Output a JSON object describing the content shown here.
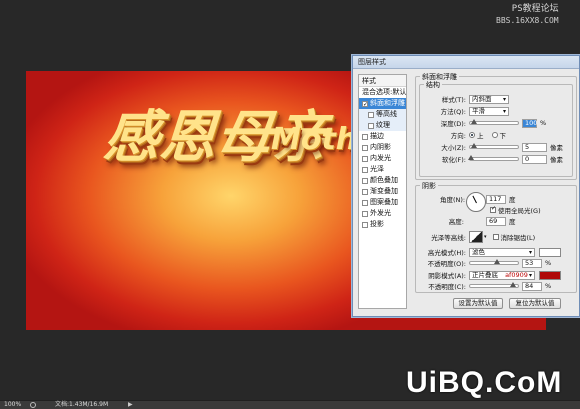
{
  "watermark": {
    "line1": "PS教程论坛",
    "line2": "BBS.16XX8.COM"
  },
  "logo": "UiBQ.CoM",
  "artwork": {
    "main_text": "感恩母亲",
    "sub_text": "Mothe"
  },
  "status": {
    "zoom": "100%",
    "doc_info": "文档:1.43M/16.9M"
  },
  "dialog": {
    "title": "图层样式",
    "left_panel": {
      "header": "样式",
      "items": [
        {
          "label": "混合选项:默认",
          "checkbox": false,
          "checked": false
        },
        {
          "label": "斜面和浮雕",
          "checkbox": true,
          "checked": true,
          "selected": true
        },
        {
          "label": "等高线",
          "checkbox": true,
          "checked": false,
          "sub": true
        },
        {
          "label": "纹理",
          "checkbox": true,
          "checked": false,
          "sub": true
        },
        {
          "label": "描边",
          "checkbox": true,
          "checked": false
        },
        {
          "label": "内阴影",
          "checkbox": true,
          "checked": false
        },
        {
          "label": "内发光",
          "checkbox": true,
          "checked": false
        },
        {
          "label": "光泽",
          "checkbox": true,
          "checked": false
        },
        {
          "label": "颜色叠加",
          "checkbox": true,
          "checked": false
        },
        {
          "label": "渐变叠加",
          "checkbox": true,
          "checked": false
        },
        {
          "label": "图案叠加",
          "checkbox": true,
          "checked": false
        },
        {
          "label": "外发光",
          "checkbox": true,
          "checked": false
        },
        {
          "label": "投影",
          "checkbox": true,
          "checked": false
        }
      ]
    },
    "bevel": {
      "section_title": "斜面和浮雕",
      "structure_title": "结构",
      "style_label": "样式(T):",
      "style_value": "内斜面",
      "technique_label": "方法(Q):",
      "technique_value": "平滑",
      "depth_label": "深度(D):",
      "depth_value": "100",
      "depth_unit": "%",
      "direction_label": "方向:",
      "dir_up": "上",
      "dir_down": "下",
      "size_label": "大小(Z):",
      "size_value": "5",
      "size_unit": "像素",
      "soften_label": "软化(F):",
      "soften_value": "0",
      "soften_unit": "像素"
    },
    "shading": {
      "title": "阴影",
      "angle_label": "角度(N):",
      "angle_value": "117",
      "angle_unit": "度",
      "global_light_label": "使用全局光(G)",
      "altitude_label": "高度:",
      "altitude_value": "69",
      "altitude_unit": "度",
      "gloss_label": "光泽等高线:",
      "antialias_label": "消除锯齿(L)",
      "highlight_mode_label": "高光模式(H):",
      "highlight_mode_value": "滤色",
      "highlight_color": "#ffffff",
      "hl_opacity_label": "不透明度(O):",
      "hl_opacity_value": "53",
      "hl_opacity_unit": "%",
      "shadow_mode_label": "阴影模式(A):",
      "shadow_mode_value": "正片叠底",
      "shadow_hex": "af0909",
      "shadow_color": "#af0909",
      "sh_opacity_label": "不透明度(C):",
      "sh_opacity_value": "84",
      "sh_opacity_unit": "%"
    },
    "buttons": {
      "set_default": "设置为默认值",
      "reset_default": "复位为默认值"
    }
  }
}
